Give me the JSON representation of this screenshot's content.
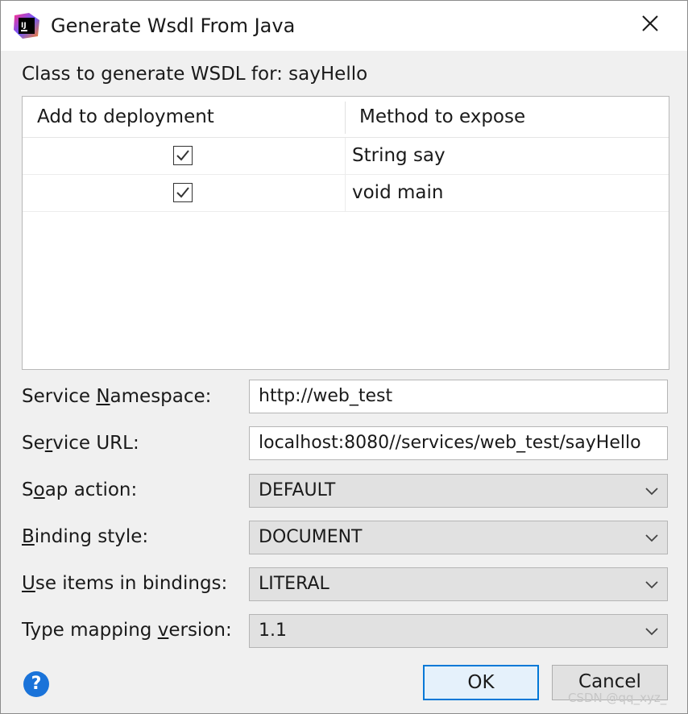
{
  "window": {
    "title": "Generate Wsdl From Java",
    "app_icon": "intellij-idea-icon",
    "close_icon": "close-icon"
  },
  "class_label": "Class to generate WSDL for:  sayHello",
  "table": {
    "columns": [
      "Add to deployment",
      "Method to expose"
    ],
    "rows": [
      {
        "checked": true,
        "method": "String say"
      },
      {
        "checked": true,
        "method": "void main"
      }
    ]
  },
  "form": {
    "namespace": {
      "label_pre": "Service ",
      "label_key": "N",
      "label_post": "amespace:",
      "value": "http://web_test"
    },
    "url": {
      "label_pre": "Se",
      "label_key": "r",
      "label_post": "vice URL:",
      "value": "localhost:8080//services/web_test/sayHello"
    },
    "soap_action": {
      "label_pre": "S",
      "label_key": "o",
      "label_post": "ap action:",
      "value": "DEFAULT"
    },
    "binding_style": {
      "label_pre": "",
      "label_key": "B",
      "label_post": "inding style:",
      "value": "DOCUMENT"
    },
    "use_items": {
      "label_pre": "",
      "label_key": "U",
      "label_post": "se items in bindings:",
      "value": "LITERAL"
    },
    "type_mapping": {
      "label_pre": "Type mapping ",
      "label_key": "v",
      "label_post": "ersion:",
      "value": "1.1"
    }
  },
  "buttons": {
    "help": "?",
    "ok": "OK",
    "cancel": "Cancel"
  },
  "watermark": "CSDN @qq_xyz_"
}
